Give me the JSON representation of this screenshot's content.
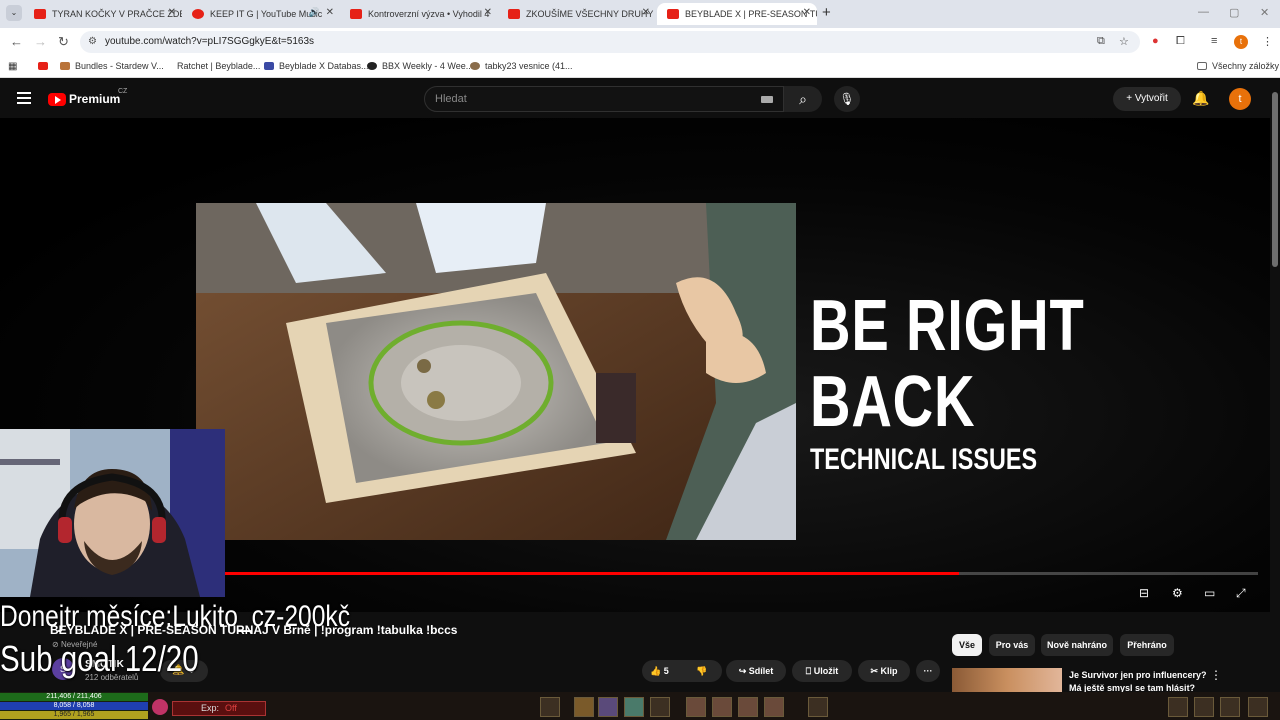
{
  "browser": {
    "tabs": [
      {
        "title": "TYRAN KOČKY V PRAČCE ZDEN",
        "active": false
      },
      {
        "title": "KEEP IT G | YouTube Music",
        "active": false
      },
      {
        "title": "Kontroverzní výzva • Vyhodil 4",
        "active": false
      },
      {
        "title": "ZKOUŠÍME VŠECHNY DRUHY C",
        "active": false
      },
      {
        "title": "BEYBLADE X | PRE-SEASON TU",
        "active": true
      }
    ],
    "url": "youtube.com/watch?v=pLI7SGGgkyE&t=5163s",
    "bookmarks": [
      "Bundles - Stardew V...",
      "Ratchet | Beyblade...",
      "Beyblade X Databas...",
      "BBX Weekly - 4 Wee...",
      "tabky23 vesnice (41..."
    ],
    "all_bookmarks": "Všechny záložky",
    "profile_initial": "t"
  },
  "youtube": {
    "logo_text": "Premium",
    "region": "CZ",
    "search_placeholder": "Hledat",
    "create_label": "+ Vytvořit",
    "avatar_initial": "t"
  },
  "video": {
    "overlay_line1": "BE RIGHT",
    "overlay_line2": "BACK",
    "overlay_line3": "TECHNICAL ISSUES",
    "progress": 0.76,
    "title": "BEYBLADE X | PRE-SEASON TURNAJ V Brně | !program !tabulka !bccs",
    "visibility": "Neveřejné",
    "channel_initial": "S",
    "channel_name": "SMOTIK",
    "subscribers": "212 odběratelů"
  },
  "stream_overlay": {
    "donor_line": "Donejtr měsíce:Lukito_cz-200kč",
    "sub_goal": "Sub goal 12/20"
  },
  "actions": {
    "likes": "5",
    "share": "Sdílet",
    "save": "Uložit",
    "clip": "Klip"
  },
  "chips": [
    "Vše",
    "Pro vás",
    "Nově nahráno",
    "Přehráno"
  ],
  "recommendation": {
    "title": "Je Survivor jen pro influencery? Má ještě smysl se tam hlásit?"
  },
  "hud": {
    "hp": "211,406 / 211,406",
    "mp": "8,058 / 8,058",
    "sp": "1,965 / 1,965",
    "exp_label": "Exp:",
    "exp_state": "Off"
  },
  "colors": {
    "youtube_red": "#ff0000",
    "chip_active_bg": "#f1f1f1",
    "dark_bg": "#0f0f0f"
  }
}
